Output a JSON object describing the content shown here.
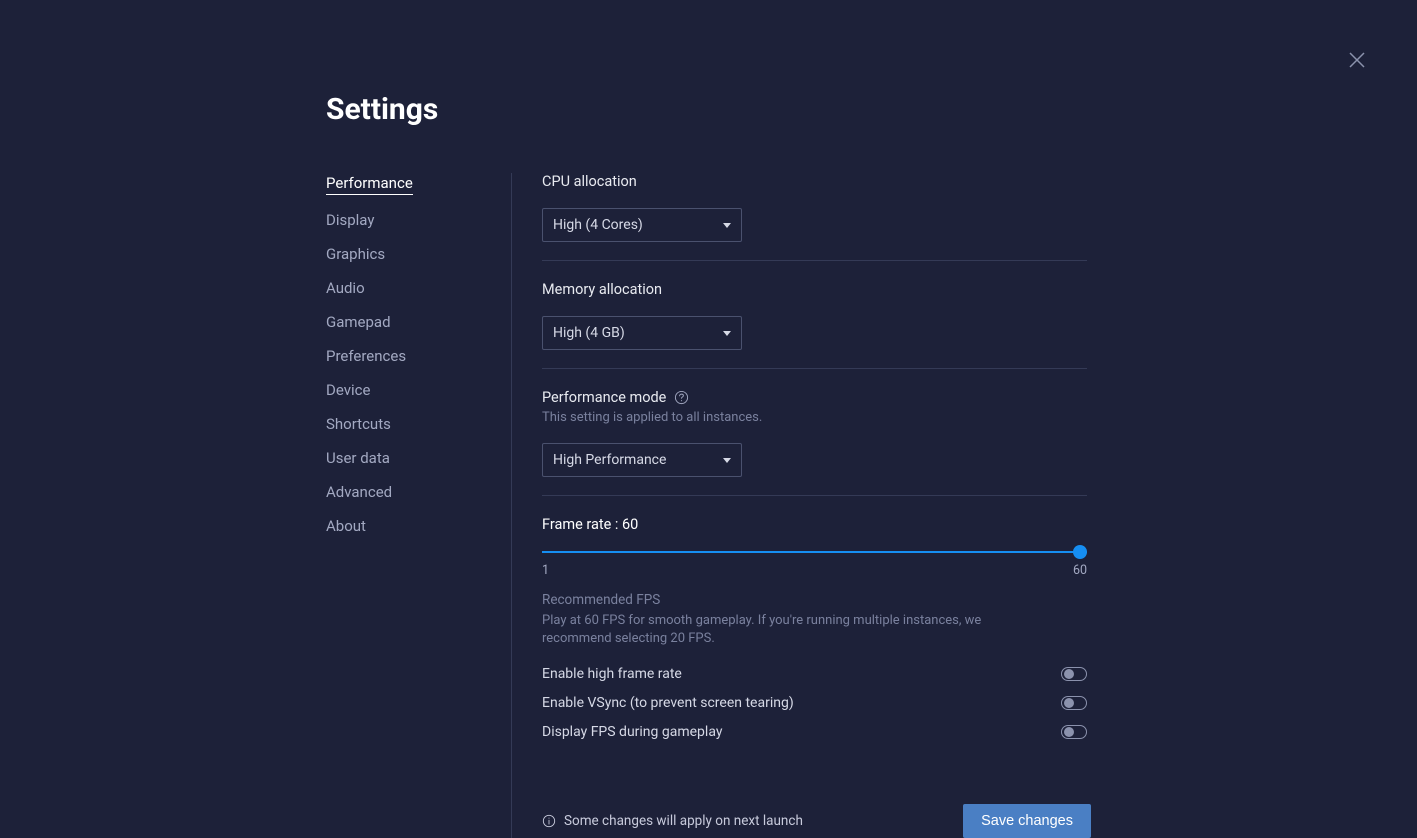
{
  "title": "Settings",
  "sidebar": {
    "items": [
      {
        "label": "Performance",
        "active": true
      },
      {
        "label": "Display"
      },
      {
        "label": "Graphics"
      },
      {
        "label": "Audio"
      },
      {
        "label": "Gamepad"
      },
      {
        "label": "Preferences"
      },
      {
        "label": "Device"
      },
      {
        "label": "Shortcuts"
      },
      {
        "label": "User data"
      },
      {
        "label": "Advanced"
      },
      {
        "label": "About"
      }
    ]
  },
  "cpu": {
    "label": "CPU allocation",
    "value": "High (4 Cores)"
  },
  "memory": {
    "label": "Memory allocation",
    "value": "High (4 GB)"
  },
  "perfmode": {
    "label": "Performance mode",
    "sublabel": "This setting is applied to all instances.",
    "value": "High Performance"
  },
  "framerate": {
    "label_prefix": "Frame rate : ",
    "value": "60",
    "min": "1",
    "max": "60",
    "rec_title": "Recommended FPS",
    "rec_body": "Play at 60 FPS for smooth gameplay. If you're running multiple instances, we recommend selecting 20 FPS."
  },
  "toggles": {
    "high_frame": "Enable high frame rate",
    "vsync": "Enable VSync (to prevent screen tearing)",
    "display_fps": "Display FPS during gameplay"
  },
  "footer": {
    "note": "Some changes will apply on next launch",
    "save": "Save changes"
  }
}
